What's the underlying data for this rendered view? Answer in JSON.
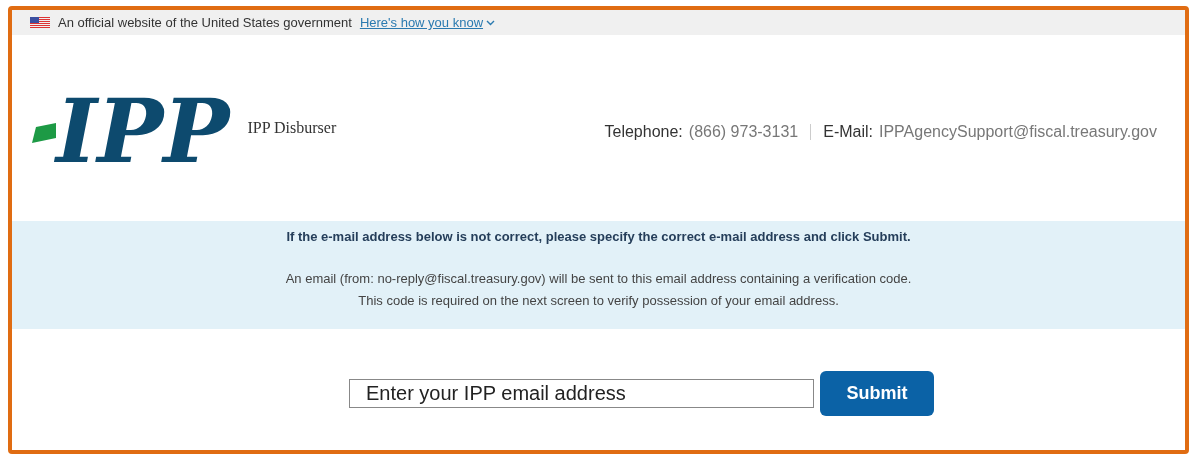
{
  "gov_banner": {
    "text": "An official website of the United States government",
    "link": "Here's how you know"
  },
  "header": {
    "logo_text": "IPP",
    "site_name": "IPP Disburser",
    "telephone_label": "Telephone:",
    "telephone": "(866) 973-3131",
    "email_label": "E-Mail:",
    "email": "IPPAgencySupport@fiscal.treasury.gov"
  },
  "notice": {
    "heading": "If the e-mail address below is not correct, please specify the correct e-mail address and click Submit.",
    "lines": [
      "An email (from: no-reply@fiscal.treasury.gov) will be sent to this email address containing a verification code.",
      "This code is required on the next screen to verify possession of your email address."
    ]
  },
  "form": {
    "email_field": {
      "placeholder": "Enter your IPP email address"
    },
    "submit": "Submit"
  }
}
